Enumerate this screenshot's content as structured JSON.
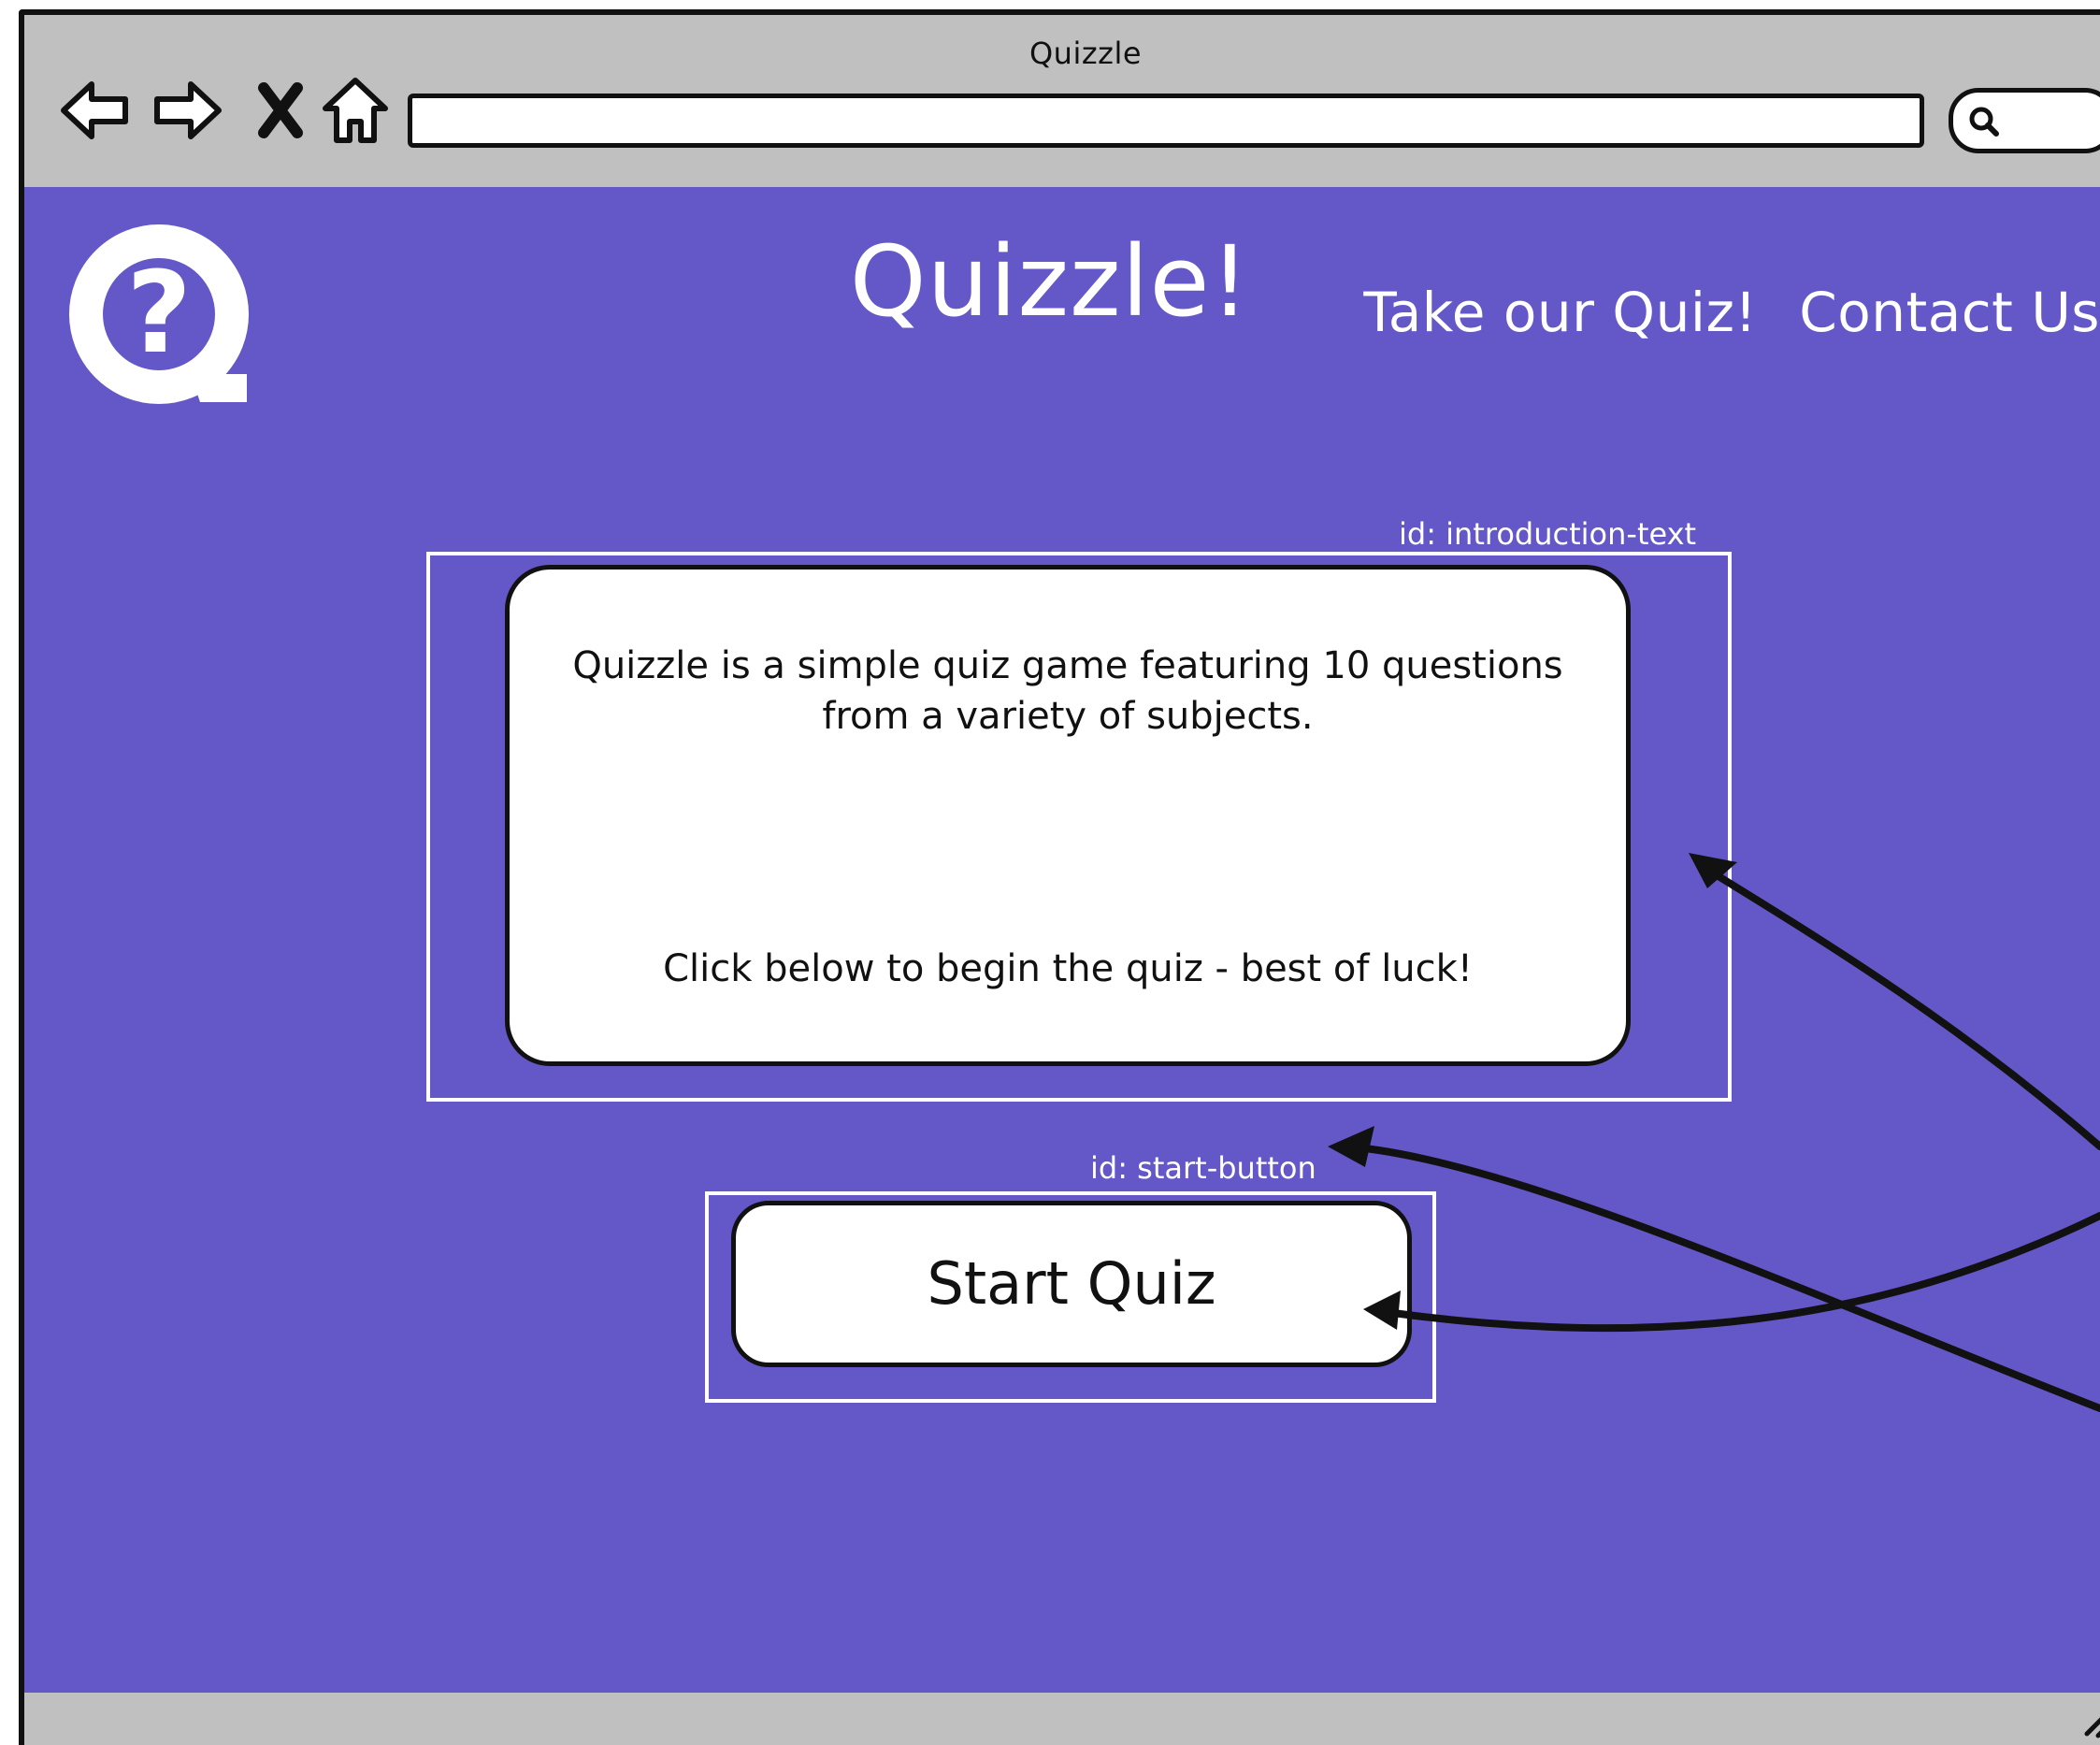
{
  "window": {
    "title": "Quizzle"
  },
  "toolbar": {
    "back_icon": "back-arrow-icon",
    "forward_icon": "forward-arrow-icon",
    "stop_icon": "close-x-icon",
    "home_icon": "home-icon",
    "address_value": "",
    "search_icon": "search-icon"
  },
  "header": {
    "logo_icon": "question-mark-q-logo",
    "nav": [
      {
        "label": "Take our Quiz!"
      },
      {
        "label": "Contact Us"
      }
    ]
  },
  "main": {
    "title": "Quizzle!",
    "intro": {
      "id_label": "id: introduction-text",
      "paragraph1": "Quizzle is a simple quiz game featuring 10 questions from a variety of subjects.",
      "paragraph2": "Click below to begin the quiz - best of luck!"
    },
    "start": {
      "id_label": "id: start-button",
      "button_label": "Start Quiz"
    }
  },
  "colors": {
    "page_background": "#6458c8",
    "chrome": "#c0c0c0",
    "card": "#ffffff",
    "ink": "#111111"
  }
}
